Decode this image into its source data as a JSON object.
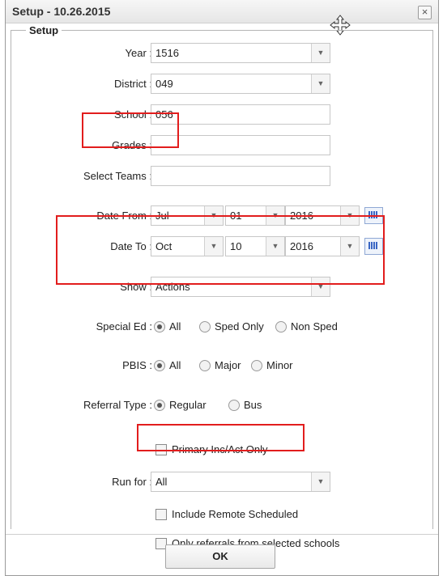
{
  "dialog": {
    "title": "Setup - 10.26.2015",
    "section_legend": "Setup",
    "close_glyph": "×"
  },
  "fields": {
    "year": {
      "label": "Year :",
      "value": "1516"
    },
    "district": {
      "label": "District :",
      "value": "049"
    },
    "school": {
      "label": "School :",
      "value": "056"
    },
    "grades": {
      "label": "Grades :",
      "value": ""
    },
    "select_teams": {
      "label": "Select Teams :",
      "value": ""
    },
    "date_from": {
      "label": "Date From :",
      "month": "Jul",
      "day": "01",
      "year": "2016"
    },
    "date_to": {
      "label": "Date To :",
      "month": "Oct",
      "day": "10",
      "year": "2016"
    },
    "show": {
      "label": "Show :",
      "value": "Actions"
    },
    "run_for": {
      "label": "Run for :",
      "value": "All"
    }
  },
  "special_ed": {
    "label": "Special Ed :",
    "options": [
      "All",
      "Sped Only",
      "Non Sped"
    ],
    "selected": "All"
  },
  "pbis": {
    "label": "PBIS :",
    "options": [
      "All",
      "Major",
      "Minor"
    ],
    "selected": "All"
  },
  "referral_type": {
    "label": "Referral Type :",
    "options": [
      "Regular",
      "Bus"
    ],
    "selected": "Regular"
  },
  "checkboxes": {
    "primary": "Primary Inc/Act Only",
    "remote": "Include Remote Scheduled",
    "selected_schools": "Only referrals from selected schools"
  },
  "ok_button": "OK",
  "colors": {
    "highlight": "#e21d1d",
    "calendar_icon": "#3a66c4"
  },
  "icons": {
    "dropdown": "chevron-down-icon",
    "calendar": "calendar-icon",
    "move": "move-cursor-icon"
  }
}
